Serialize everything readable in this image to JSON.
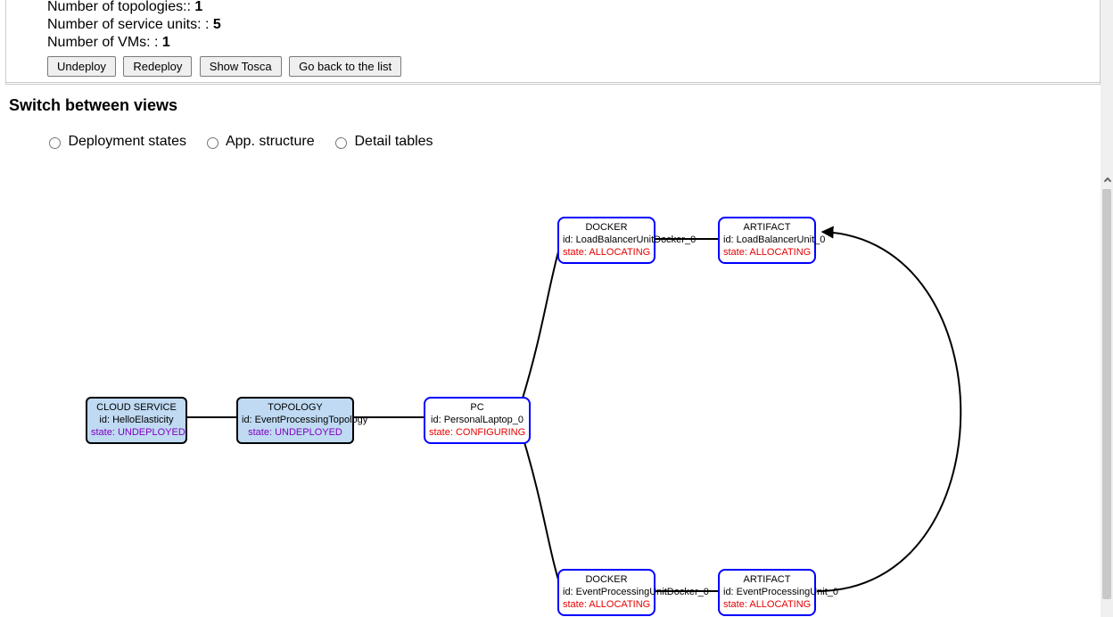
{
  "info": {
    "topologies_label": "Number of topologies:: ",
    "topologies_value": "1",
    "units_label": "Number of service units: : ",
    "units_value": "5",
    "vms_label": "Number of VMs: : ",
    "vms_value": "1"
  },
  "buttons": {
    "undeploy": "Undeploy",
    "redeploy": "Redeploy",
    "show_tosca": "Show Tosca",
    "go_back": "Go back to the list"
  },
  "switch_title": "Switch between views",
  "radios": {
    "deployment": "Deployment states",
    "app": "App. structure",
    "detail": "Detail tables"
  },
  "nodes": {
    "cloud": {
      "title": "CLOUD SERVICE",
      "id": "id: HelloElasticity",
      "state": "state: UNDEPLOYED"
    },
    "topology": {
      "title": "TOPOLOGY",
      "id": "id: EventProcessingTopology",
      "state": "state: UNDEPLOYED"
    },
    "pc": {
      "title": "PC",
      "id": "id: PersonalLaptop_0",
      "state": "state: CONFIGURING"
    },
    "docker_top": {
      "title": "DOCKER",
      "id": "id: LoadBalancerUnitDocker_0",
      "state": "state: ALLOCATING"
    },
    "artifact_top": {
      "title": "ARTIFACT",
      "id": "id: LoadBalancerUnit_0",
      "state": "state: ALLOCATING"
    },
    "docker_bottom": {
      "title": "DOCKER",
      "id": "id: EventProcessingUnitDocker_0",
      "state": "state: ALLOCATING"
    },
    "artifact_bottom": {
      "title": "ARTIFACT",
      "id": "id: EventProcessingUnit_0",
      "state": "state: ALLOCATING"
    }
  },
  "chart_data": {
    "type": "diagram",
    "nodes": [
      {
        "id": "cloud",
        "label": "CLOUD SERVICE",
        "sub": "HelloElasticity",
        "state": "UNDEPLOYED"
      },
      {
        "id": "topology",
        "label": "TOPOLOGY",
        "sub": "EventProcessingTopology",
        "state": "UNDEPLOYED"
      },
      {
        "id": "pc",
        "label": "PC",
        "sub": "PersonalLaptop_0",
        "state": "CONFIGURING"
      },
      {
        "id": "docker_top",
        "label": "DOCKER",
        "sub": "LoadBalancerUnitDocker_0",
        "state": "ALLOCATING"
      },
      {
        "id": "artifact_top",
        "label": "ARTIFACT",
        "sub": "LoadBalancerUnit_0",
        "state": "ALLOCATING"
      },
      {
        "id": "docker_bottom",
        "label": "DOCKER",
        "sub": "EventProcessingUnitDocker_0",
        "state": "ALLOCATING"
      },
      {
        "id": "artifact_bottom",
        "label": "ARTIFACT",
        "sub": "EventProcessingUnit_0",
        "state": "ALLOCATING"
      }
    ],
    "edges": [
      [
        "cloud",
        "topology"
      ],
      [
        "topology",
        "pc"
      ],
      [
        "pc",
        "docker_top"
      ],
      [
        "pc",
        "docker_bottom"
      ],
      [
        "docker_top",
        "artifact_top"
      ],
      [
        "docker_bottom",
        "artifact_bottom"
      ],
      [
        "artifact_bottom",
        "artifact_top"
      ]
    ]
  }
}
